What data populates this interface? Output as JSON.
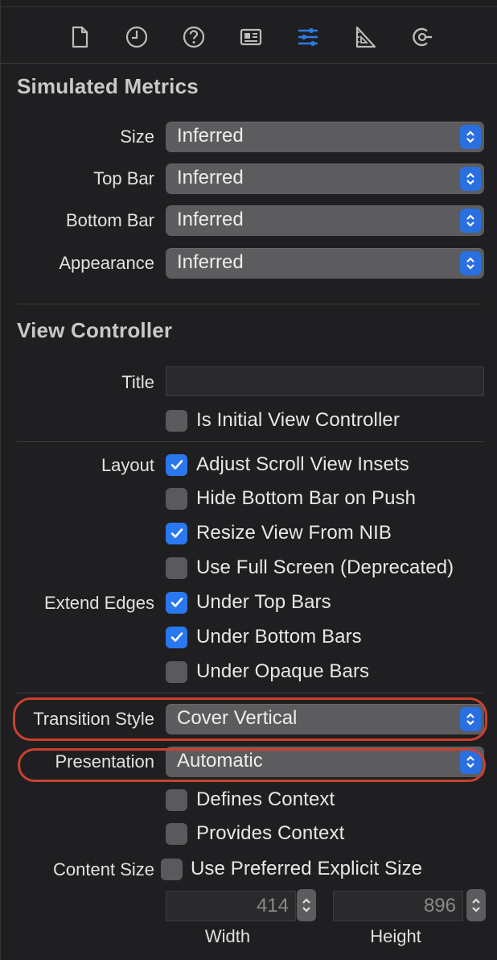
{
  "toolbar": {
    "icons": [
      "file-inspector-icon",
      "history-icon",
      "quick-help-icon",
      "identity-inspector-icon",
      "attributes-inspector-icon",
      "size-inspector-icon",
      "connections-inspector-icon"
    ],
    "selected": "attributes-inspector-icon",
    "accent": "#2d7be8"
  },
  "simulated_metrics": {
    "title": "Simulated Metrics",
    "rows": [
      {
        "label": "Size",
        "value": "Inferred"
      },
      {
        "label": "Top Bar",
        "value": "Inferred"
      },
      {
        "label": "Bottom Bar",
        "value": "Inferred"
      },
      {
        "label": "Appearance",
        "value": "Inferred"
      }
    ]
  },
  "view_controller": {
    "title": "View Controller",
    "title_field": {
      "label": "Title",
      "value": ""
    },
    "initial": {
      "label": "Is Initial View Controller",
      "checked": false
    },
    "layout": {
      "label": "Layout",
      "options": [
        {
          "label": "Adjust Scroll View Insets",
          "checked": true
        },
        {
          "label": "Hide Bottom Bar on Push",
          "checked": false
        },
        {
          "label": "Resize View From NIB",
          "checked": true
        },
        {
          "label": "Use Full Screen (Deprecated)",
          "checked": false
        }
      ]
    },
    "extend_edges": {
      "label": "Extend Edges",
      "options": [
        {
          "label": "Under Top Bars",
          "checked": true
        },
        {
          "label": "Under Bottom Bars",
          "checked": true
        },
        {
          "label": "Under Opaque Bars",
          "checked": false
        }
      ]
    },
    "transition_style": {
      "label": "Transition Style",
      "value": "Cover Vertical"
    },
    "presentation": {
      "label": "Presentation",
      "value": "Automatic"
    },
    "context": [
      {
        "label": "Defines Context",
        "checked": false
      },
      {
        "label": "Provides Context",
        "checked": false
      }
    ],
    "content_size": {
      "label": "Content Size",
      "checkbox_label": "Use Preferred Explicit Size",
      "checked": false,
      "width": {
        "value": "414",
        "caption": "Width"
      },
      "height": {
        "value": "896",
        "caption": "Height"
      }
    }
  },
  "colors": {
    "background": "#1f1f21",
    "popup": "#5c5c5e",
    "checkbox_on": "#2a78f0",
    "highlight": "#c9412f"
  }
}
